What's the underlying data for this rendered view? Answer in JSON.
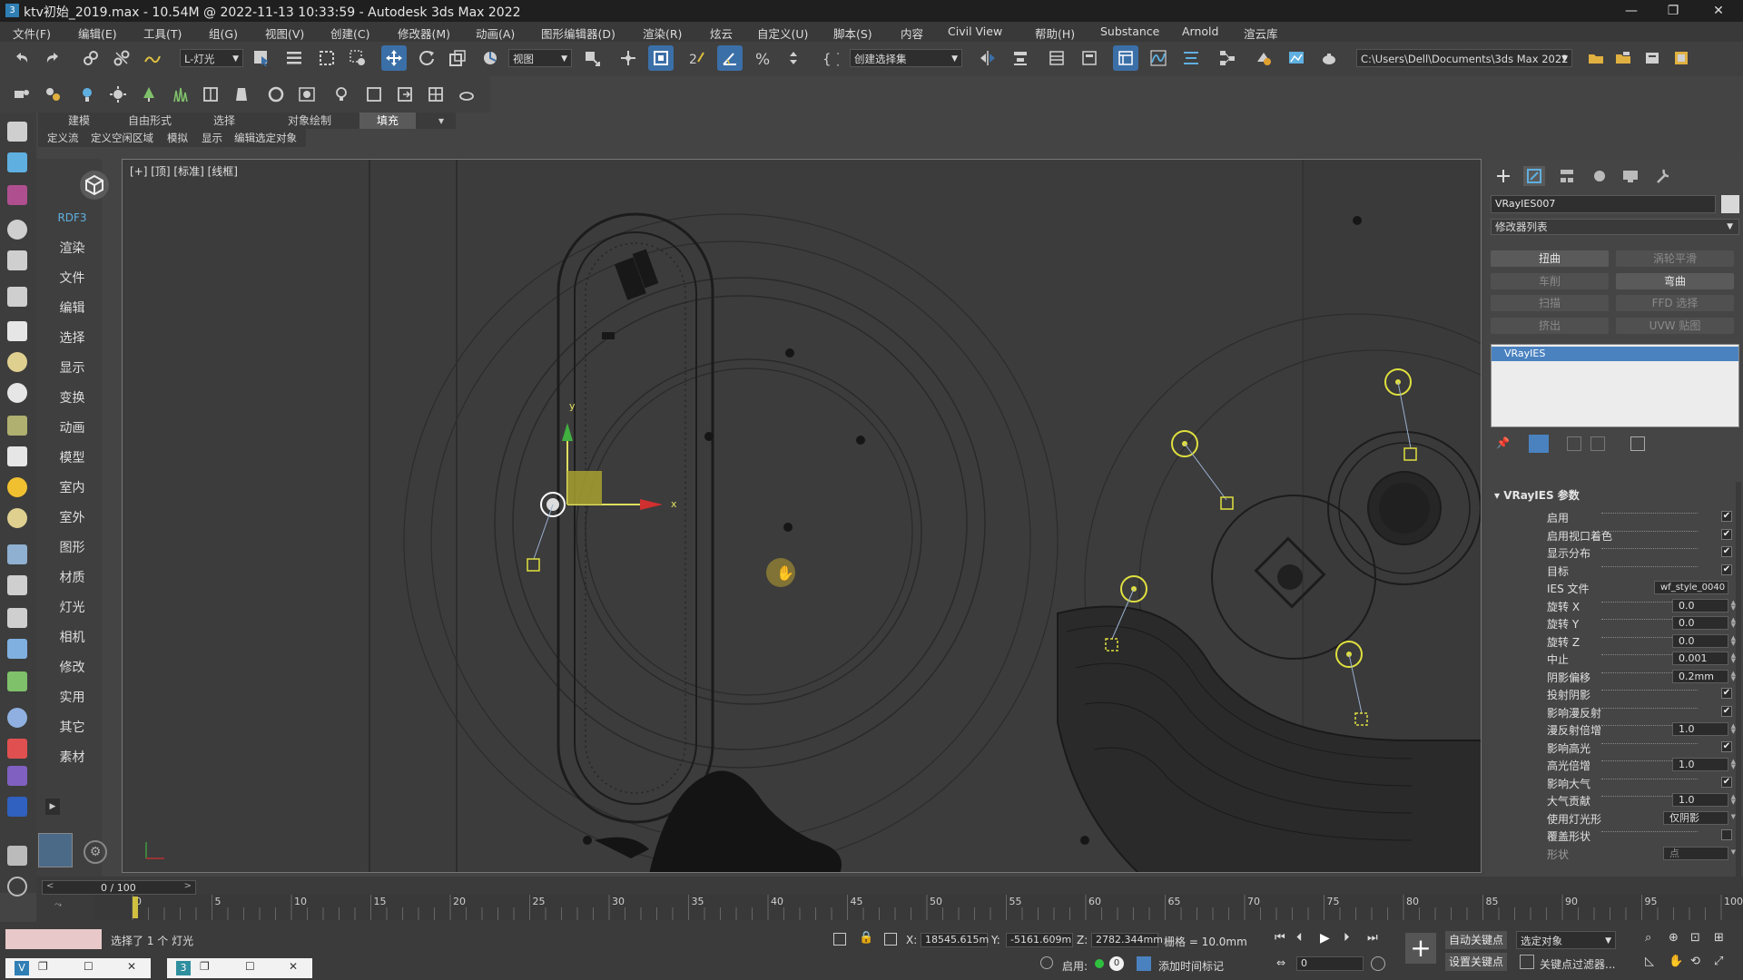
{
  "window": {
    "title": "ktv初始_2019.max - 10.54M @ 2022-11-13 10:33:59 - Autodesk 3ds Max 2022",
    "minimize": "—",
    "maximize": "❐",
    "close": "✕"
  },
  "menu": [
    "文件(F)",
    "编辑(E)",
    "工具(T)",
    "组(G)",
    "视图(V)",
    "创建(C)",
    "修改器(M)",
    "动画(A)",
    "图形编辑器(D)",
    "渲染(R)",
    "炫云",
    "自定义(U)",
    "脚本(S)",
    "内容",
    "Civil View",
    "帮助(H)",
    "Substance",
    "Arnold",
    "渲云库"
  ],
  "toolbar": {
    "layer_dropdown": "L-灯光",
    "view_dropdown": "视图",
    "selection_set": "创建选择集",
    "project_path": "C:\\Users\\Dell\\Documents\\3ds Max 2022"
  },
  "ribbon": {
    "tabs": [
      "建模",
      "自由形式",
      "选择",
      "对象绘制",
      "填充"
    ],
    "active_tab": "填充",
    "sub_items": [
      "定义流",
      "定义空闲区域",
      "模拟",
      "显示",
      "编辑选定对象"
    ]
  },
  "side_menu": {
    "header": "RDF3",
    "items": [
      "渲染",
      "文件",
      "编辑",
      "选择",
      "显示",
      "变换",
      "动画",
      "模型",
      "室内",
      "室外",
      "图形",
      "材质",
      "灯光",
      "相机",
      "修改",
      "实用",
      "其它",
      "素材"
    ]
  },
  "viewport": {
    "label": "[+] [顶] [标准] [线框]",
    "gizmo_x": "x",
    "gizmo_y": "y"
  },
  "command_panel": {
    "object_name": "VRayIES007",
    "modifier_list": "修改器列表",
    "modifier_buttons": [
      {
        "label": "扭曲",
        "enabled": true
      },
      {
        "label": "涡轮平滑",
        "enabled": false
      },
      {
        "label": "车削",
        "enabled": false
      },
      {
        "label": "弯曲",
        "enabled": true
      },
      {
        "label": "扫描",
        "enabled": false
      },
      {
        "label": "FFD 选择",
        "enabled": false
      },
      {
        "label": "挤出",
        "enabled": false
      },
      {
        "label": "UVW 贴图",
        "enabled": false
      }
    ],
    "stack_item": "VRayIES",
    "rollout_title": "VRayIES 参数",
    "params": [
      {
        "label": "启用",
        "type": "check",
        "value": "✔"
      },
      {
        "label": "启用视口着色",
        "type": "check",
        "value": "✔"
      },
      {
        "label": "显示分布",
        "type": "check",
        "value": "✔"
      },
      {
        "label": "目标",
        "type": "check",
        "value": "✔"
      },
      {
        "label": "IES 文件",
        "type": "text",
        "value": "wf_style_0040"
      },
      {
        "label": "旋转 X",
        "type": "num",
        "value": "0.0"
      },
      {
        "label": "旋转 Y",
        "type": "num",
        "value": "0.0"
      },
      {
        "label": "旋转 Z",
        "type": "num",
        "value": "0.0"
      },
      {
        "label": "中止",
        "type": "num",
        "value": "0.001"
      },
      {
        "label": "阴影偏移",
        "type": "num",
        "value": "0.2mm"
      },
      {
        "label": "投射阴影",
        "type": "check",
        "value": "✔"
      },
      {
        "label": "影响漫反射",
        "type": "check",
        "value": "✔"
      },
      {
        "label": "漫反射倍增",
        "type": "num",
        "value": "1.0"
      },
      {
        "label": "影响高光",
        "type": "check",
        "value": "✔"
      },
      {
        "label": "高光倍增",
        "type": "num",
        "value": "1.0"
      },
      {
        "label": "影响大气",
        "type": "check",
        "value": "✔"
      },
      {
        "label": "大气贡献",
        "type": "num",
        "value": "1.0"
      },
      {
        "label": "使用灯光形",
        "type": "dd",
        "value": "仅阴影"
      },
      {
        "label": "覆盖形状",
        "type": "check",
        "value": ""
      },
      {
        "label": "形状",
        "type": "dd",
        "value": "点"
      }
    ]
  },
  "timeline": {
    "frame_counter": "0 / 100",
    "ticks": [
      "0",
      "5",
      "10",
      "15",
      "20",
      "25",
      "30",
      "35",
      "40",
      "45",
      "50",
      "55",
      "60",
      "65",
      "70",
      "75",
      "80",
      "85",
      "90",
      "95",
      "100"
    ],
    "current_frame": 0
  },
  "status": {
    "selection": "选择了 1 个 灯光",
    "x_label": "X:",
    "x": "18545.615m",
    "y_label": "Y:",
    "y": "-5161.609m",
    "z_label": "Z:",
    "z": "2782.344mm",
    "grid": "栅格 = 10.0mm",
    "enable": "启用:",
    "enable_value": "0",
    "add_time_tag": "添加时间标记",
    "auto_key": "自动关键点",
    "set_key": "设置关键点",
    "selected_object": "选定对象",
    "key_filter": "关键点过滤器...",
    "frame_spinner": "0"
  }
}
